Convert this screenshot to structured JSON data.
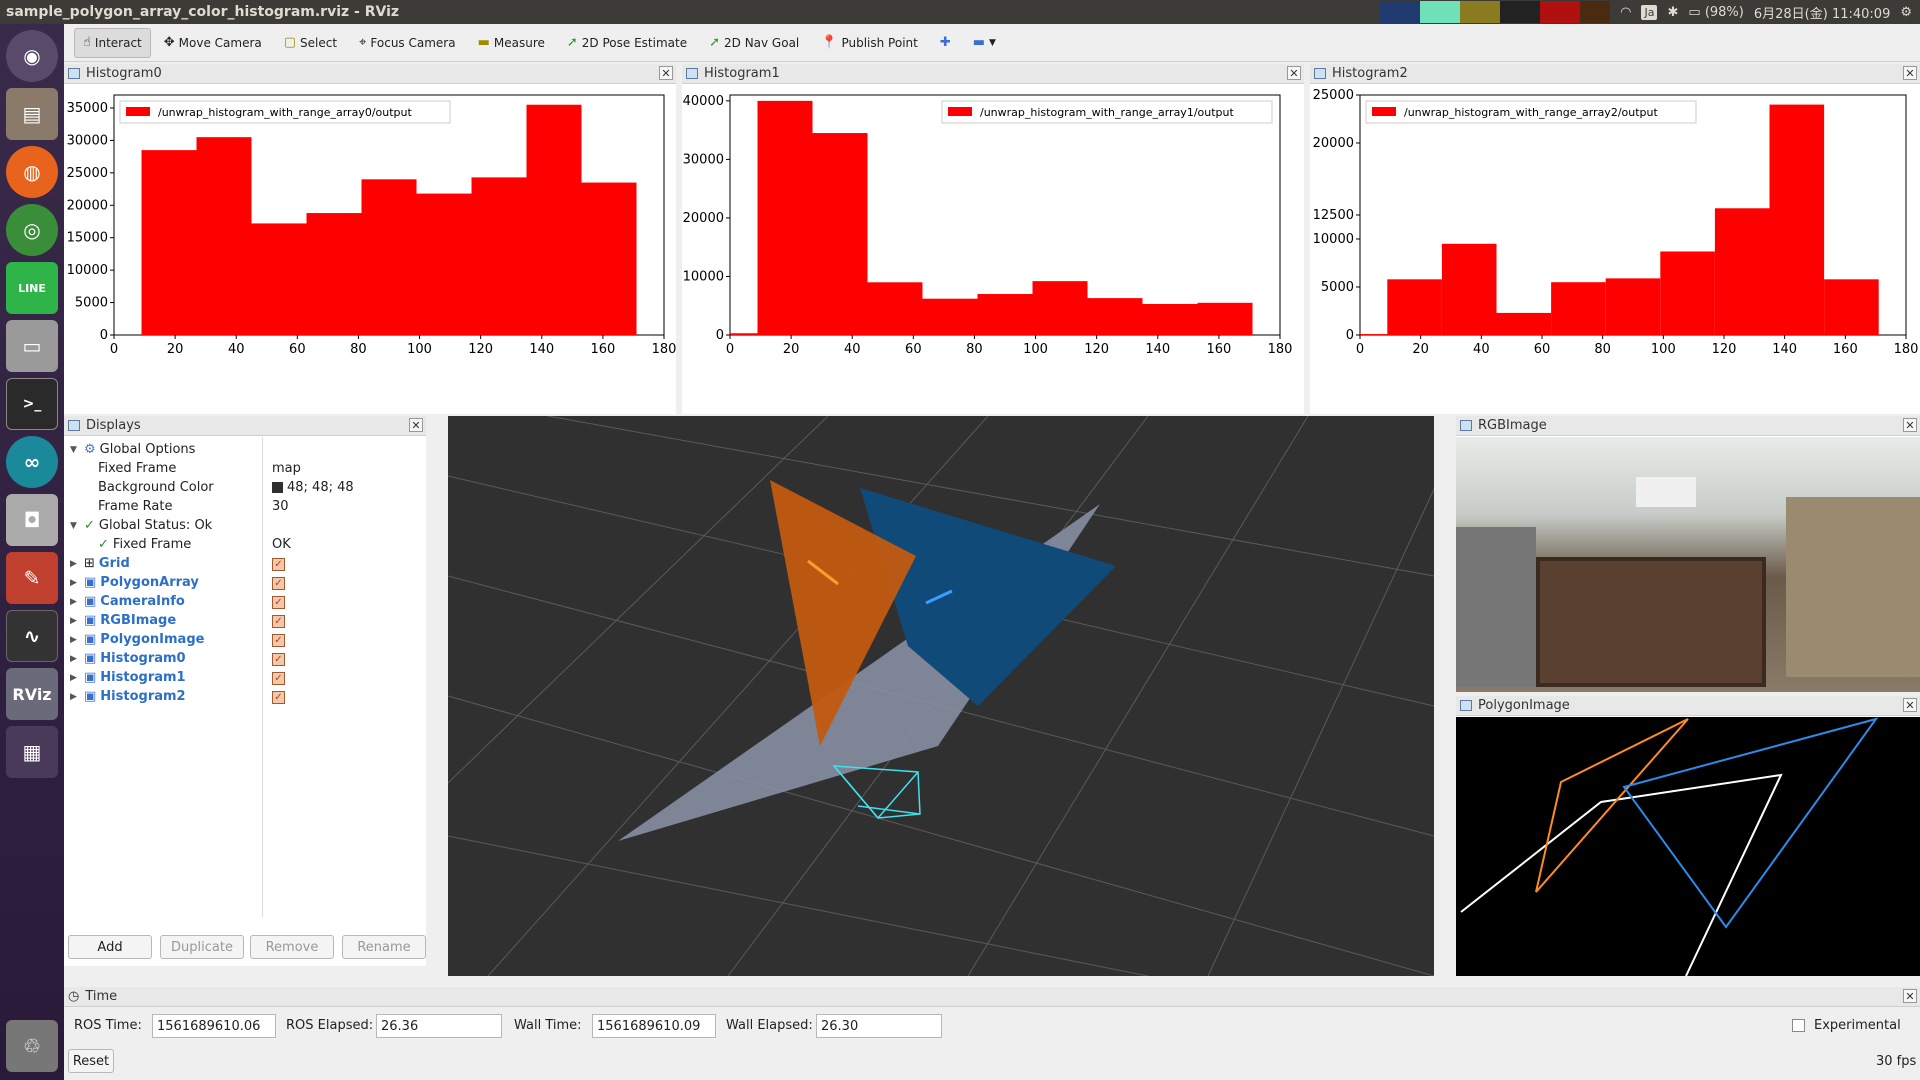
{
  "window": {
    "title": "sample_polygon_array_color_histogram.rviz - RViz",
    "battery": "(98%)",
    "clock": "6月28日(金) 11:40:09",
    "kbd": "Ja"
  },
  "toolbar": {
    "interact": "Interact",
    "move_camera": "Move Camera",
    "select": "Select",
    "focus_camera": "Focus Camera",
    "measure": "Measure",
    "pose_estimate": "2D Pose Estimate",
    "nav_goal": "2D Nav Goal",
    "publish_point": "Publish Point"
  },
  "histograms": [
    {
      "title": "Histogram0",
      "legend": "/unwrap_histogram_with_range_array0/output",
      "y_ticks": [
        "0",
        "5000",
        "10000",
        "15000",
        "20000",
        "25000",
        "30000",
        "35000"
      ],
      "y_ticks_shown": [
        "0",
        "5000",
        "10000",
        "15000",
        "20000",
        "25000",
        "30000",
        "35000"
      ],
      "x_ticks": [
        "0",
        "20",
        "40",
        "60",
        "80",
        "100",
        "120",
        "140",
        "160",
        "180"
      ]
    },
    {
      "title": "Histogram1",
      "legend": "/unwrap_histogram_with_range_array1/output",
      "y_ticks": [
        "0",
        "10000",
        "20000",
        "30000",
        "40000"
      ],
      "x_ticks": [
        "0",
        "20",
        "40",
        "60",
        "80",
        "100",
        "120",
        "140",
        "160",
        "180"
      ]
    },
    {
      "title": "Histogram2",
      "legend": "/unwrap_histogram_with_range_array2/output",
      "y_ticks": [
        "0",
        "5000",
        "10000",
        "12500",
        "20000",
        "25000"
      ],
      "x_ticks": [
        "0",
        "20",
        "40",
        "60",
        "80",
        "100",
        "120",
        "140",
        "160",
        "180"
      ]
    }
  ],
  "chart_data": [
    {
      "type": "bar",
      "title": "Histogram0",
      "series": [
        {
          "name": "/unwrap_histogram_with_range_array0/output",
          "color": "#ff0000"
        }
      ],
      "bin_edges": [
        9,
        27,
        45,
        63,
        81,
        99,
        117,
        135,
        153,
        171
      ],
      "values": [
        28500,
        30500,
        17200,
        18800,
        24000,
        21800,
        24300,
        35500,
        23500
      ],
      "xlim": [
        0,
        180
      ],
      "ylim": [
        0,
        37000
      ]
    },
    {
      "type": "bar",
      "title": "Histogram1",
      "series": [
        {
          "name": "/unwrap_histogram_with_range_array1/output",
          "color": "#ff0000"
        }
      ],
      "bin_edges": [
        0,
        9,
        27,
        45,
        63,
        81,
        99,
        117,
        135,
        153,
        171
      ],
      "values": [
        300,
        40000,
        34500,
        9000,
        6200,
        7000,
        9200,
        6300,
        5300,
        5500
      ],
      "xlim": [
        0,
        180
      ],
      "ylim": [
        0,
        41000
      ]
    },
    {
      "type": "bar",
      "title": "Histogram2",
      "series": [
        {
          "name": "/unwrap_histogram_with_range_array2/output",
          "color": "#ff0000"
        }
      ],
      "bin_edges": [
        0,
        9,
        27,
        45,
        63,
        81,
        99,
        117,
        135,
        153,
        171
      ],
      "values": [
        100,
        5800,
        9500,
        2300,
        5500,
        5900,
        8700,
        13200,
        24000,
        5800
      ],
      "xlim": [
        0,
        180
      ],
      "ylim": [
        0,
        25000
      ]
    }
  ],
  "displays": {
    "title": "Displays",
    "global_options": "Global Options",
    "fixed_frame_label": "Fixed Frame",
    "fixed_frame_value": "map",
    "bg_label": "Background Color",
    "bg_value": "48; 48; 48",
    "frame_rate_label": "Frame Rate",
    "frame_rate_value": "30",
    "global_status": "Global Status: Ok",
    "fixed_frame_status": "Fixed Frame",
    "fixed_frame_status_value": "OK",
    "items": [
      "Grid",
      "PolygonArray",
      "CameraInfo",
      "RGBImage",
      "PolygonImage",
      "Histogram0",
      "Histogram1",
      "Histogram2"
    ],
    "buttons": {
      "add": "Add",
      "duplicate": "Duplicate",
      "remove": "Remove",
      "rename": "Rename"
    }
  },
  "rgb_panel": {
    "title": "RGBImage"
  },
  "polygon_panel": {
    "title": "PolygonImage"
  },
  "time": {
    "title": "Time",
    "ros_time_label": "ROS Time:",
    "ros_time": "1561689610.06",
    "ros_elapsed_label": "ROS Elapsed:",
    "ros_elapsed": "26.36",
    "wall_time_label": "Wall Time:",
    "wall_time": "1561689610.09",
    "wall_elapsed_label": "Wall Elapsed:",
    "wall_elapsed": "26.30",
    "experimental": "Experimental",
    "reset": "Reset",
    "fps": "30 fps"
  }
}
